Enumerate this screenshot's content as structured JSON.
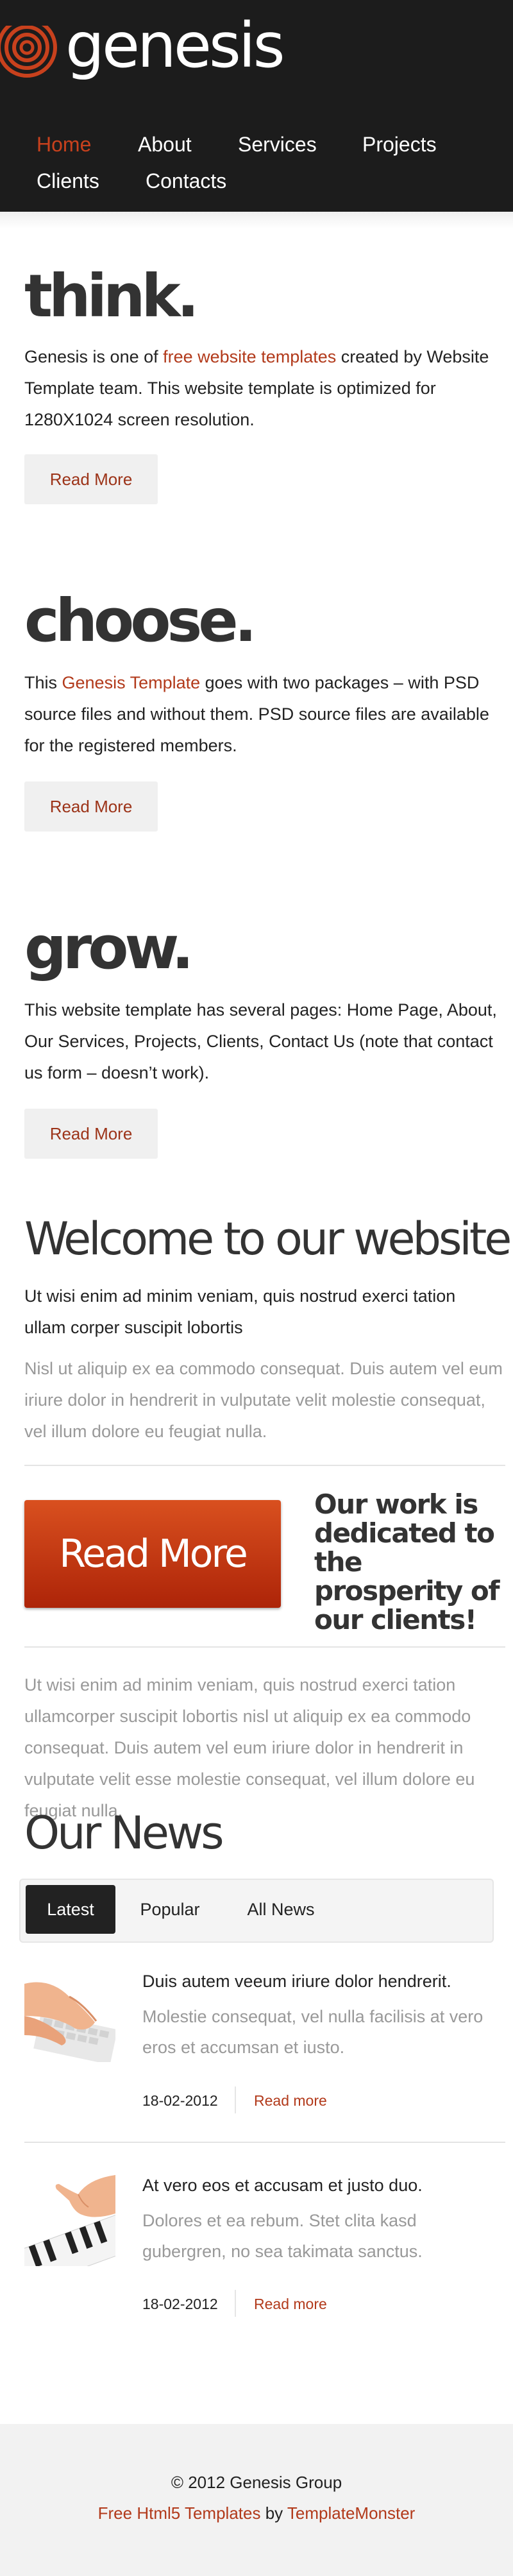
{
  "header": {
    "logo_text": "genesis",
    "nav": [
      {
        "label": "Home",
        "active": true
      },
      {
        "label": "About",
        "active": false
      },
      {
        "label": "Services",
        "active": false
      },
      {
        "label": "Projects",
        "active": false
      },
      {
        "label": "Clients",
        "active": false
      },
      {
        "label": "Contacts",
        "active": false
      }
    ]
  },
  "sections": [
    {
      "heading": "think.",
      "text_before": "Genesis is one of ",
      "link": "free website templates",
      "text_after": " created by Website Template team. This website template is optimized for 1280X1024 screen resolution.",
      "button": "Read More"
    },
    {
      "heading": "choose.",
      "text_before": "This ",
      "link": "Genesis Template",
      "text_after": " goes with two packages – with PSD source files and without them. PSD source files are available for the registered members.",
      "button": "Read More"
    },
    {
      "heading": "grow.",
      "text_before": "This website template has several pages: Home Page, About, Our Services, Projects, Clients, Contact Us (note that contact us form – doesn’t work).",
      "link": "",
      "text_after": "",
      "button": "Read More"
    }
  ],
  "welcome": {
    "title": "Welcome to our website!",
    "lead": "Ut wisi enim ad minim veniam, quis nostrud exerci tation ullam corper suscipit lobortis",
    "grey_text": "Nisl ut aliquip ex ea commodo consequat. Duis autem vel eum iriure dolor in hendrerit in vulputate velit molestie consequat, vel illum dolore eu feugiat nulla.",
    "big_button": "Read More",
    "dedication": "Our work is dedicated to the prosperity of our clients!",
    "bottom_text": "Ut wisi enim ad minim veniam, quis nostrud exerci tation ullamcorper suscipit lobortis nisl ut aliquip ex ea commodo consequat. Duis autem vel eum iriure dolor in hendrerit in vulputate velit esse molestie consequat, vel illum dolore eu feugiat nulla."
  },
  "news": {
    "title": "Our News",
    "tabs": [
      "Latest",
      "Popular",
      "All News"
    ],
    "active_tab": "Latest",
    "items": [
      {
        "headline": "Duis autem veeum iriure dolor hendrerit.",
        "summary": "Molestie consequat, vel nulla facilisis at vero eros et accumsan et iusto.",
        "date": "18-02-2012",
        "more": "Read more",
        "image": "hands-on-keyboard"
      },
      {
        "headline": "At vero eos et accusam et justo duo.",
        "summary": "Dolores et ea rebum. Stet clita kasd gubergren, no sea takimata sanctus.",
        "date": "18-02-2012",
        "more": "Read more",
        "image": "hand-on-piano-keys"
      }
    ]
  },
  "footer": {
    "copyright": "© 2012 Genesis Group",
    "link1": "Free Html5 Templates",
    "by": " by ",
    "link2": "TemplateMonster"
  },
  "colors": {
    "accent": "#b23a1b",
    "header_bg": "#1c1c1c",
    "button_red": "#c23a13"
  }
}
